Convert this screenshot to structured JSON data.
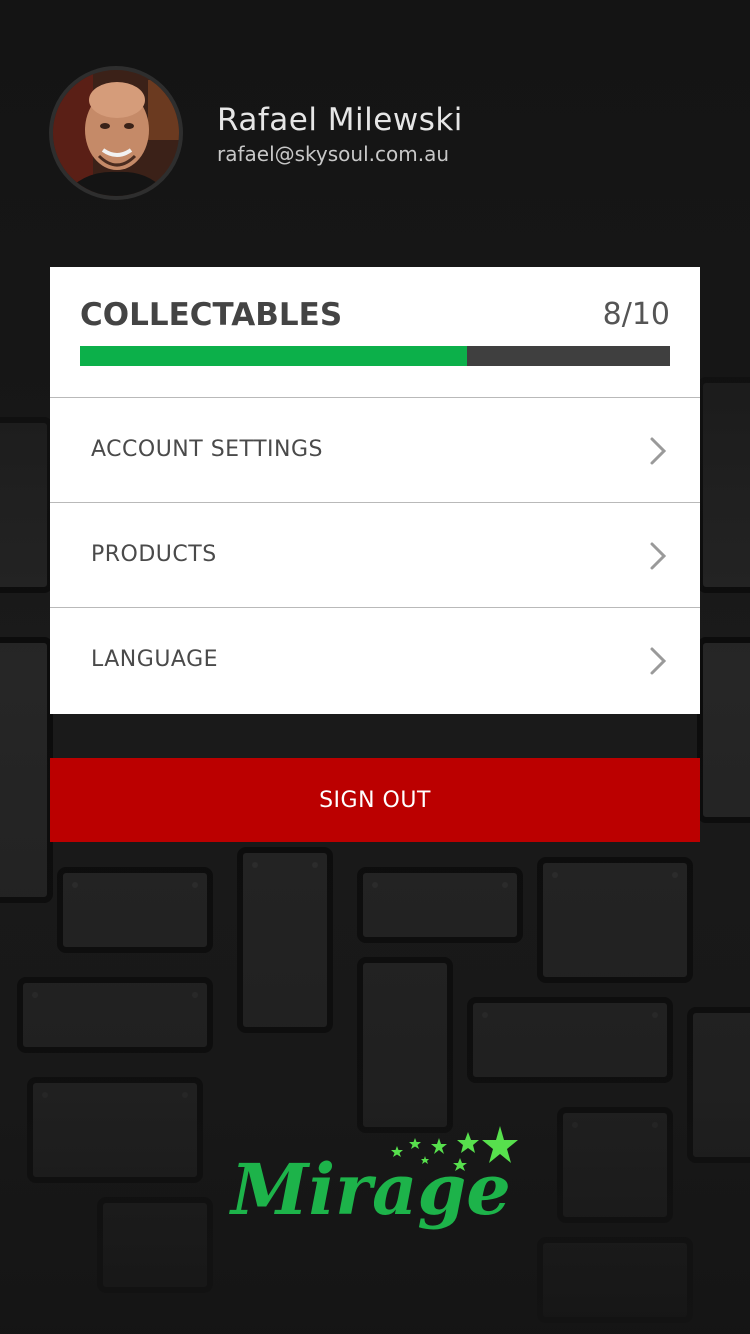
{
  "profile": {
    "name": "Rafael Milewski",
    "email": "rafael@skysoul.com.au"
  },
  "collectables": {
    "title": "COLLECTABLES",
    "count_label": "8/10",
    "progress_fraction": 0.656
  },
  "menu": {
    "items": [
      {
        "label": "ACCOUNT SETTINGS",
        "icon": "chevron-right-icon"
      },
      {
        "label": "PRODUCTS",
        "icon": "chevron-right-icon"
      },
      {
        "label": "LANGUAGE",
        "icon": "chevron-right-icon"
      }
    ]
  },
  "actions": {
    "sign_out_label": "SIGN OUT"
  },
  "brand": {
    "logo_text": "Mirage",
    "logo_color": "#1db34a",
    "star_color": "#57e04d"
  },
  "colors": {
    "background": "#141414",
    "progress_fill": "#0cb04a",
    "progress_track": "#3f3f3f",
    "sign_out": "#bb0000",
    "card": "#ffffff"
  }
}
